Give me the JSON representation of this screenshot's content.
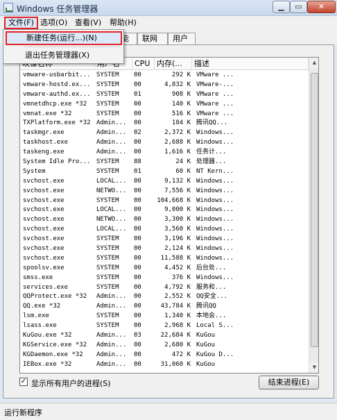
{
  "window": {
    "title": "Windows 任务管理器"
  },
  "titlebar_buttons": {
    "minimize": "▁",
    "maximize": "▭",
    "close": "✕"
  },
  "menubar": {
    "file": "文件(F)",
    "options": "选项(O)",
    "view": "查看(V)",
    "help": "帮助(H)"
  },
  "file_menu": {
    "new_task": "新建任务(运行...)(N)",
    "exit": "退出任务管理器(X)"
  },
  "tabs": {
    "performance": "能",
    "networking": "联网",
    "users": "用户"
  },
  "columns": {
    "name": "映像名称",
    "user": "用户名",
    "cpu": "CPU",
    "memory": "内存(...",
    "description": "描述"
  },
  "processes": [
    {
      "name": "vmware-usbarbit...",
      "user": "SYSTEM",
      "cpu": "00",
      "mem": "292 K",
      "desc": "VMware ..."
    },
    {
      "name": "vmware-hostd.ex...",
      "user": "SYSTEM",
      "cpu": "00",
      "mem": "4,832 K",
      "desc": "VMware-..."
    },
    {
      "name": "vmware-authd.ex...",
      "user": "SYSTEM",
      "cpu": "01",
      "mem": "908 K",
      "desc": "VMware ..."
    },
    {
      "name": "vmnetdhcp.exe *32",
      "user": "SYSTEM",
      "cpu": "00",
      "mem": "140 K",
      "desc": "VMware ..."
    },
    {
      "name": "vmnat.exe *32",
      "user": "SYSTEM",
      "cpu": "00",
      "mem": "516 K",
      "desc": "VMware ..."
    },
    {
      "name": "TXPlatform.exe *32",
      "user": "Admin...",
      "cpu": "00",
      "mem": "184 K",
      "desc": "腾讯QQ..."
    },
    {
      "name": "taskmgr.exe",
      "user": "Admin...",
      "cpu": "02",
      "mem": "2,372 K",
      "desc": "Windows..."
    },
    {
      "name": "taskhost.exe",
      "user": "Admin...",
      "cpu": "00",
      "mem": "2,688 K",
      "desc": "Windows..."
    },
    {
      "name": "taskeng.exe",
      "user": "Admin...",
      "cpu": "00",
      "mem": "1,616 K",
      "desc": "任务计..."
    },
    {
      "name": "System Idle Pro...",
      "user": "SYSTEM",
      "cpu": "88",
      "mem": "24 K",
      "desc": "处理器..."
    },
    {
      "name": "System",
      "user": "SYSTEM",
      "cpu": "01",
      "mem": "60 K",
      "desc": "NT Kern..."
    },
    {
      "name": "svchost.exe",
      "user": "LOCAL...",
      "cpu": "00",
      "mem": "9,132 K",
      "desc": "Windows..."
    },
    {
      "name": "svchost.exe",
      "user": "NETWO...",
      "cpu": "00",
      "mem": "7,556 K",
      "desc": "Windows..."
    },
    {
      "name": "svchost.exe",
      "user": "SYSTEM",
      "cpu": "00",
      "mem": "104,668 K",
      "desc": "Windows..."
    },
    {
      "name": "svchost.exe",
      "user": "LOCAL...",
      "cpu": "00",
      "mem": "9,000 K",
      "desc": "Windows..."
    },
    {
      "name": "svchost.exe",
      "user": "NETWO...",
      "cpu": "00",
      "mem": "3,300 K",
      "desc": "Windows..."
    },
    {
      "name": "svchost.exe",
      "user": "LOCAL...",
      "cpu": "00",
      "mem": "3,560 K",
      "desc": "Windows..."
    },
    {
      "name": "svchost.exe",
      "user": "SYSTEM",
      "cpu": "00",
      "mem": "3,196 K",
      "desc": "Windows..."
    },
    {
      "name": "svchost.exe",
      "user": "SYSTEM",
      "cpu": "00",
      "mem": "2,124 K",
      "desc": "Windows..."
    },
    {
      "name": "svchost.exe",
      "user": "SYSTEM",
      "cpu": "00",
      "mem": "11,588 K",
      "desc": "Windows..."
    },
    {
      "name": "spoolsv.exe",
      "user": "SYSTEM",
      "cpu": "00",
      "mem": "4,452 K",
      "desc": "后台处..."
    },
    {
      "name": "smss.exe",
      "user": "SYSTEM",
      "cpu": "00",
      "mem": "376 K",
      "desc": "Windows..."
    },
    {
      "name": "services.exe",
      "user": "SYSTEM",
      "cpu": "00",
      "mem": "4,792 K",
      "desc": "服务和..."
    },
    {
      "name": "QQProtect.exe *32",
      "user": "Admin...",
      "cpu": "00",
      "mem": "2,552 K",
      "desc": "QQ安全..."
    },
    {
      "name": "QQ.exe *32",
      "user": "Admin...",
      "cpu": "00",
      "mem": "43,784 K",
      "desc": "腾讯QQ"
    },
    {
      "name": "lsm.exe",
      "user": "SYSTEM",
      "cpu": "00",
      "mem": "1,340 K",
      "desc": "本地会..."
    },
    {
      "name": "lsass.exe",
      "user": "SYSTEM",
      "cpu": "00",
      "mem": "2,968 K",
      "desc": "Local S..."
    },
    {
      "name": "KuGou.exe *32",
      "user": "Admin...",
      "cpu": "03",
      "mem": "22,684 K",
      "desc": "KuGou"
    },
    {
      "name": "KGService.exe *32",
      "user": "Admin...",
      "cpu": "00",
      "mem": "2,680 K",
      "desc": "KuGou"
    },
    {
      "name": "KGDaemon.exe *32",
      "user": "Admin...",
      "cpu": "00",
      "mem": "472 K",
      "desc": "KuGou D..."
    },
    {
      "name": "IEBox.exe *32",
      "user": "Admin...",
      "cpu": "00",
      "mem": "31,060 K",
      "desc": "KuGou"
    }
  ],
  "show_all_users": {
    "label": "显示所有用户的进程(S)",
    "checked": true,
    "mark": "✓"
  },
  "end_process_button": "结束进程(E)",
  "scroll": {
    "up": "▲",
    "down": "▼"
  },
  "status": {
    "text": "运行新程序"
  }
}
